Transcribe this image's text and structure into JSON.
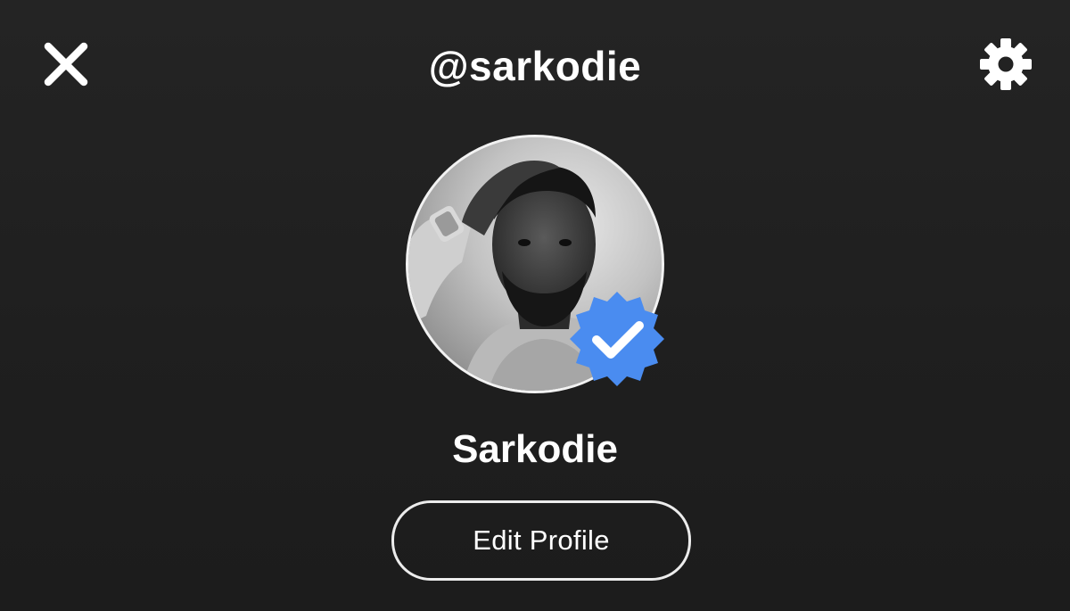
{
  "header": {
    "username": "@sarkodie",
    "close_icon": "close-icon",
    "settings_icon": "gear-icon"
  },
  "profile": {
    "display_name": "Sarkodie",
    "verified": true,
    "badge_color": "#4a8cf0"
  },
  "actions": {
    "edit_profile_label": "Edit Profile"
  }
}
